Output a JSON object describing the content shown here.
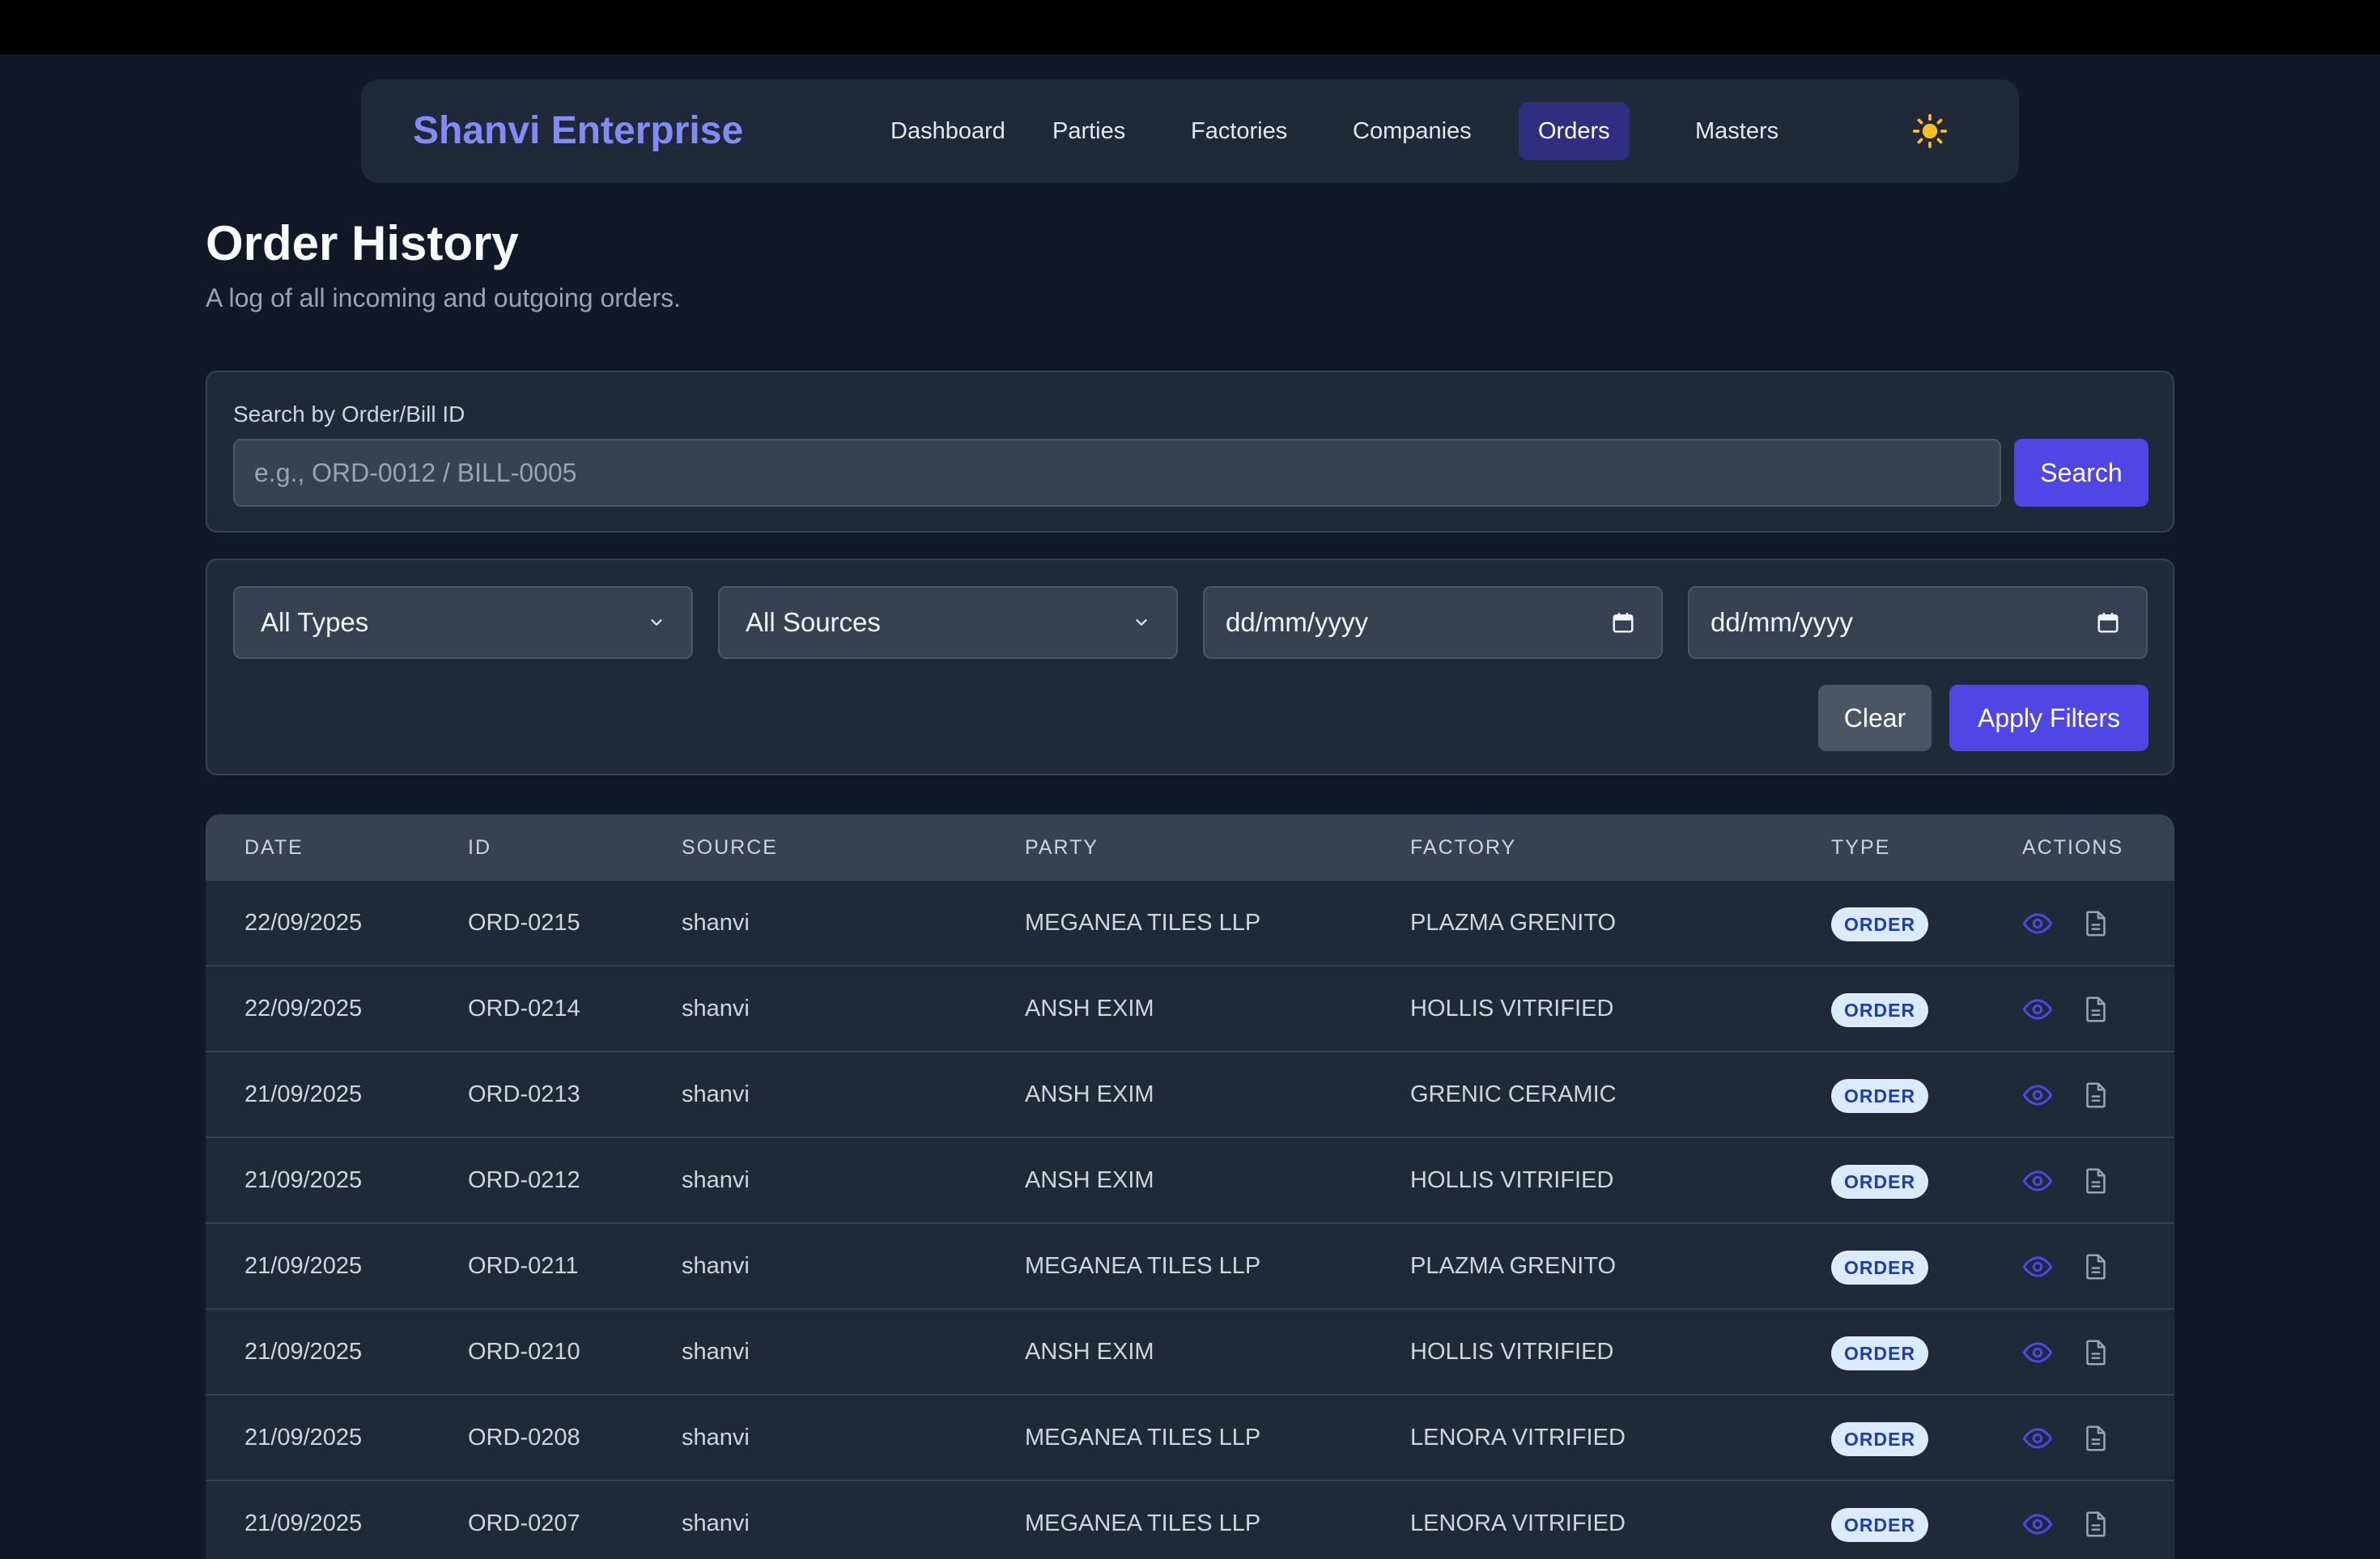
{
  "nav": {
    "brand": "Shanvi Enterprise",
    "items": [
      {
        "label": "Dashboard",
        "active": false
      },
      {
        "label": "Parties",
        "active": false
      },
      {
        "label": "Factories",
        "active": false
      },
      {
        "label": "Companies",
        "active": false
      },
      {
        "label": "Orders",
        "active": true
      },
      {
        "label": "Masters",
        "active": false
      }
    ],
    "theme_icon": "sun-icon"
  },
  "header": {
    "title": "Order History",
    "subtitle": "A log of all incoming and outgoing orders."
  },
  "search": {
    "label": "Search by Order/Bill ID",
    "placeholder": "e.g., ORD-0012 / BILL-0005",
    "value": "",
    "button": "Search"
  },
  "filters": {
    "type_select": "All Types",
    "source_select": "All Sources",
    "date_from": "dd/mm/yyyy",
    "date_to": "dd/mm/yyyy",
    "clear": "Clear",
    "apply": "Apply Filters"
  },
  "table": {
    "columns": [
      "DATE",
      "ID",
      "SOURCE",
      "PARTY",
      "FACTORY",
      "TYPE",
      "ACTIONS"
    ],
    "rows": [
      {
        "date": "22/09/2025",
        "id": "ORD-0215",
        "source": "shanvi",
        "party": "MEGANEA TILES LLP",
        "factory": "PLAZMA GRENITO",
        "type": "ORDER"
      },
      {
        "date": "22/09/2025",
        "id": "ORD-0214",
        "source": "shanvi",
        "party": "ANSH EXIM",
        "factory": "HOLLIS VITRIFIED",
        "type": "ORDER"
      },
      {
        "date": "21/09/2025",
        "id": "ORD-0213",
        "source": "shanvi",
        "party": "ANSH EXIM",
        "factory": "GRENIC CERAMIC",
        "type": "ORDER"
      },
      {
        "date": "21/09/2025",
        "id": "ORD-0212",
        "source": "shanvi",
        "party": "ANSH EXIM",
        "factory": "HOLLIS VITRIFIED",
        "type": "ORDER"
      },
      {
        "date": "21/09/2025",
        "id": "ORD-0211",
        "source": "shanvi",
        "party": "MEGANEA TILES LLP",
        "factory": "PLAZMA GRENITO",
        "type": "ORDER"
      },
      {
        "date": "21/09/2025",
        "id": "ORD-0210",
        "source": "shanvi",
        "party": "ANSH EXIM",
        "factory": "HOLLIS VITRIFIED",
        "type": "ORDER"
      },
      {
        "date": "21/09/2025",
        "id": "ORD-0208",
        "source": "shanvi",
        "party": "MEGANEA TILES LLP",
        "factory": "LENORA VITRIFIED",
        "type": "ORDER"
      },
      {
        "date": "21/09/2025",
        "id": "ORD-0207",
        "source": "shanvi",
        "party": "MEGANEA TILES LLP",
        "factory": "LENORA VITRIFIED",
        "type": "ORDER"
      }
    ],
    "action_icons": [
      "eye-icon",
      "document-icon"
    ]
  },
  "colors": {
    "accent": "#4f46e5",
    "brand": "#818cf8",
    "badge_bg": "#dbeafe",
    "badge_text": "#1e40af"
  }
}
